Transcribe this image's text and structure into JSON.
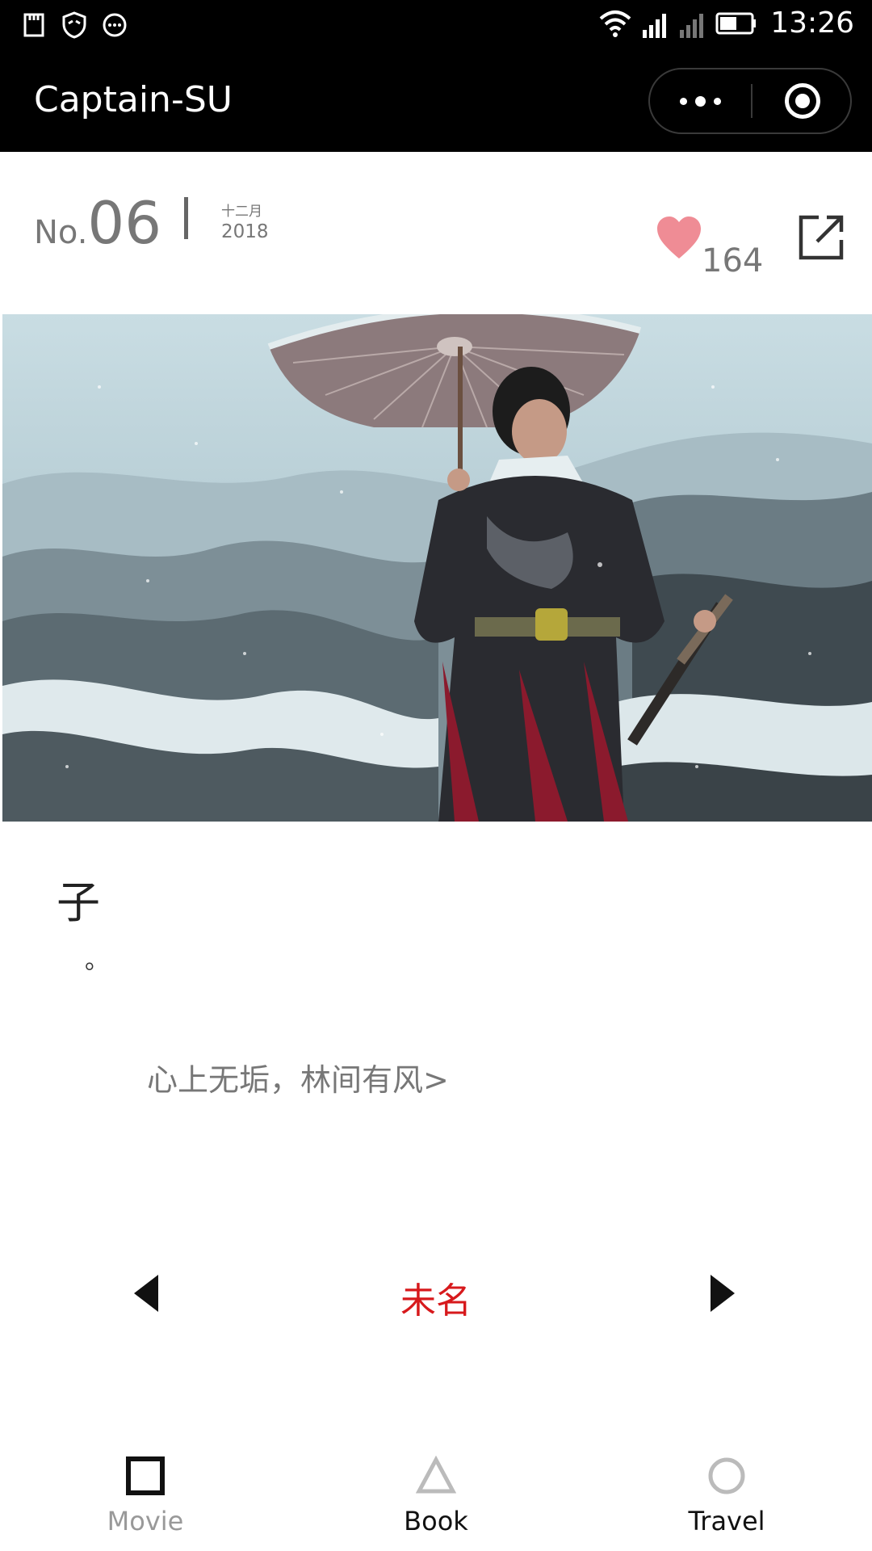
{
  "status_bar": {
    "time": "13:26",
    "left_icons": [
      "sd-card-icon",
      "shield-icon",
      "message-icon"
    ],
    "right_icons": [
      "wifi-icon",
      "signal-icon",
      "signal-icon-2",
      "battery-icon"
    ]
  },
  "title_bar": {
    "title": "Captain-SU",
    "more_icon": "more-dots-icon",
    "close_icon": "target-close-icon"
  },
  "issue": {
    "prefix": "No.",
    "number": "06",
    "month": "十二月",
    "year": "2018",
    "like_count": "164",
    "like_color": "#ef8c95",
    "share_icon": "share-icon"
  },
  "content": {
    "quote": "子",
    "quote_end": "。",
    "source_link": "心上无垢，林间有风>"
  },
  "pager": {
    "title": "未名",
    "title_color": "#d7191c",
    "prev_icon": "triangle-left-icon",
    "next_icon": "triangle-right-icon"
  },
  "tabs": [
    {
      "label": "Movie",
      "icon": "square-icon",
      "active": false
    },
    {
      "label": "Book",
      "icon": "triangle-icon",
      "active": true
    },
    {
      "label": "Travel",
      "icon": "circle-icon",
      "active": false
    }
  ]
}
